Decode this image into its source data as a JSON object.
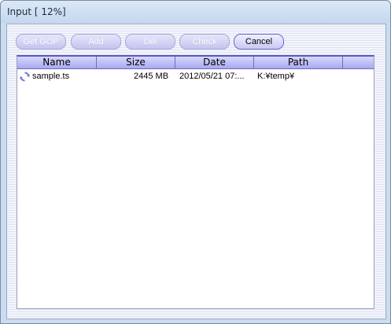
{
  "window": {
    "title": "Input [ 12%]"
  },
  "toolbar": {
    "buttons": [
      {
        "label": "Get GOP",
        "enabled": false
      },
      {
        "label": "Add",
        "enabled": false
      },
      {
        "label": "Del",
        "enabled": false
      },
      {
        "label": "Check",
        "enabled": false
      },
      {
        "label": "Cancel",
        "enabled": true
      }
    ]
  },
  "list": {
    "columns": [
      "Name",
      "Size",
      "Date",
      "Path"
    ],
    "rows": [
      {
        "icon": "refresh-icon",
        "name": "sample.ts",
        "size": "2445 MB",
        "date": "2012/05/21 07:...",
        "path": "K:¥temp¥"
      }
    ]
  },
  "colors": {
    "header_gradient_top": "#d8d8ff",
    "header_gradient_bottom": "#a8a8f0",
    "button_text_disabled": "#ffffff",
    "icon_purple": "#7070d8"
  }
}
